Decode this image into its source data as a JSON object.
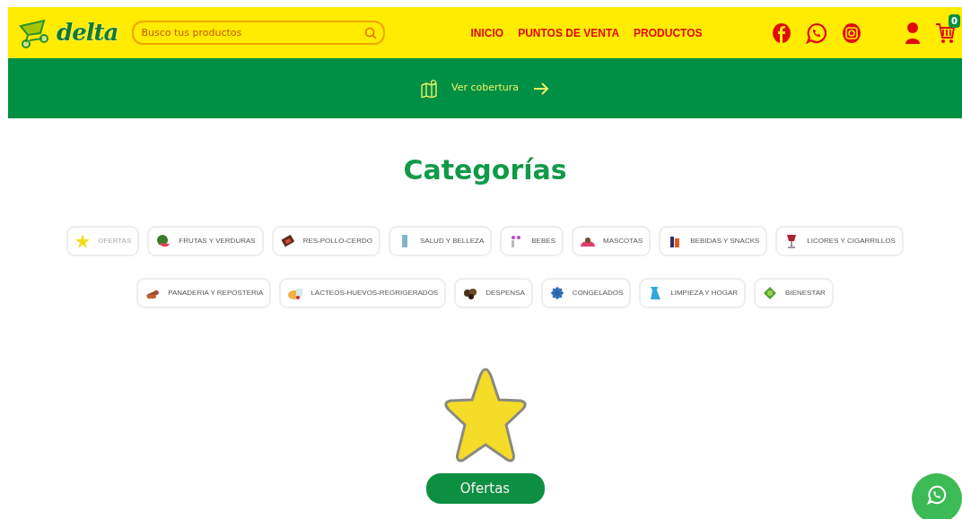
{
  "header": {
    "logo": "delta",
    "search": {
      "placeholder": "Busco tus productos"
    },
    "nav": [
      "INICIO",
      "PUNTOS DE VENTA",
      "PRODUCTOS"
    ],
    "cart_count": "0"
  },
  "coverage_bar": {
    "label": "Ver cobertura"
  },
  "categories_title": "Categorías",
  "categories": [
    {
      "label": "OFERTAS",
      "selected": true
    },
    {
      "label": "FRUTAS Y VERDURAS",
      "selected": false
    },
    {
      "label": "RES-POLLO-CERDO",
      "selected": false
    },
    {
      "label": "SALUD Y BELLEZA",
      "selected": false
    },
    {
      "label": "BEBES",
      "selected": false
    },
    {
      "label": "MASCOTAS",
      "selected": false
    },
    {
      "label": "BEBIDAS Y SNACKS",
      "selected": false
    },
    {
      "label": "LICORES Y CIGARRILLOS",
      "selected": false
    },
    {
      "label": "PANADERIA Y REPOSTERIA",
      "selected": false
    },
    {
      "label": "LACTEOS-HUEVOS-REGRIGERADOS",
      "selected": false
    },
    {
      "label": "DESPENSA",
      "selected": false
    },
    {
      "label": "CONGELADOS",
      "selected": false
    },
    {
      "label": "LIMPIEZA Y HOGAR",
      "selected": false
    },
    {
      "label": "BIENESTAR",
      "selected": false
    }
  ],
  "featured": {
    "button": "Ofertas"
  }
}
